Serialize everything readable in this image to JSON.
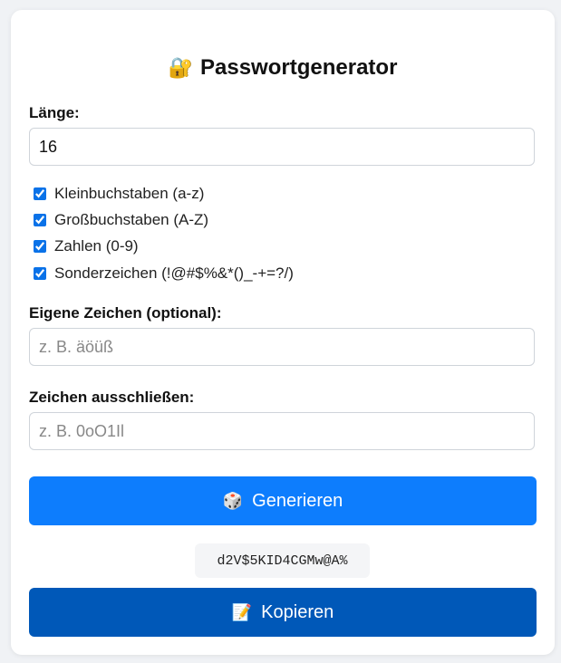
{
  "title": "Passwortgenerator",
  "icons": {
    "title": "lock-key-icon",
    "generate": "dice-icon",
    "copy": "memo-pencil-icon"
  },
  "length": {
    "label": "Länge:",
    "value": "16"
  },
  "options": [
    {
      "label": "Kleinbuchstaben (a-z)",
      "checked": true
    },
    {
      "label": "Großbuchstaben (A-Z)",
      "checked": true
    },
    {
      "label": "Zahlen (0-9)",
      "checked": true
    },
    {
      "label": "Sonderzeichen (!@#$%&*()_-+=?/)",
      "checked": true
    }
  ],
  "custom_chars": {
    "label": "Eigene Zeichen (optional):",
    "placeholder": "z. B. äöüß",
    "value": ""
  },
  "exclude_chars": {
    "label": "Zeichen ausschließen:",
    "placeholder": "z. B. 0oO1Il",
    "value": ""
  },
  "generate_button": {
    "label": "Generieren"
  },
  "password": "d2V$5KID4CGMw@A%",
  "copy_button": {
    "label": "Kopieren"
  },
  "colors": {
    "primary": "#0d7dfd",
    "copy": "#0058b8",
    "background": "#f0f2f5"
  }
}
